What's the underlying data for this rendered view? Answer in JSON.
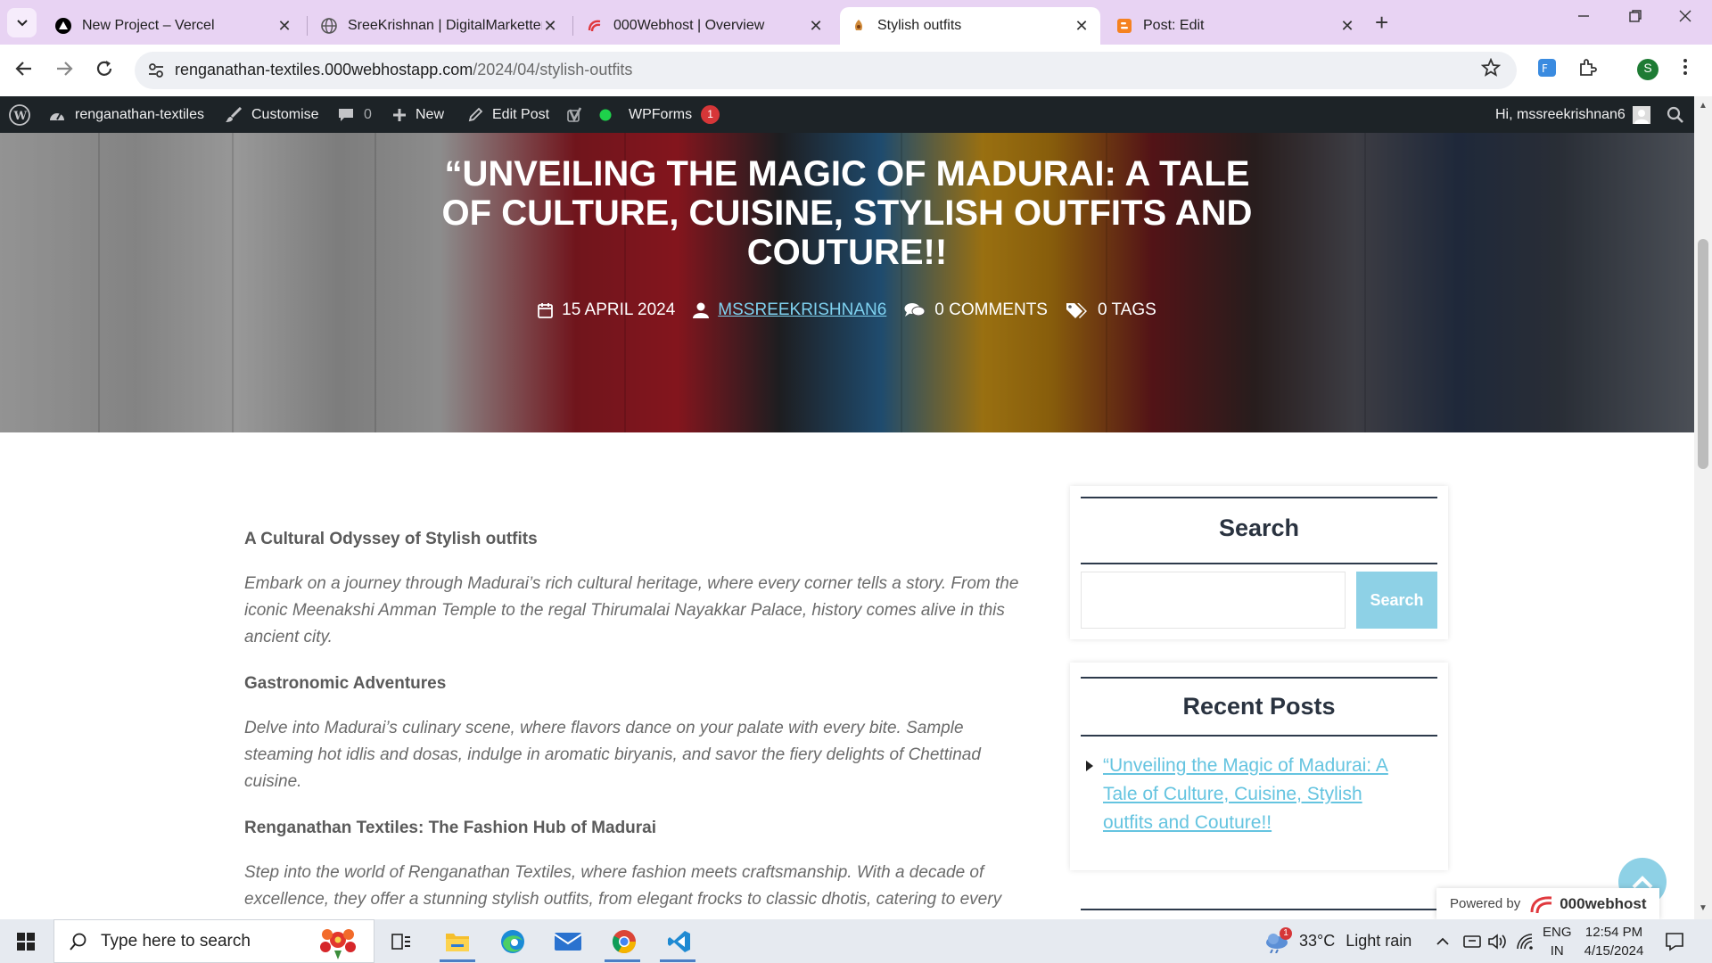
{
  "browser": {
    "tabs": [
      {
        "title": "New Project – Vercel",
        "icon": "vercel-icon"
      },
      {
        "title": "SreeKrishnan | DigitalMarketter",
        "icon": "globe-icon"
      },
      {
        "title": "000Webhost | Overview",
        "icon": "webhost-icon"
      },
      {
        "title": "Stylish outfits",
        "icon": "site-favicon-icon",
        "active": true
      },
      {
        "title": "Post: Edit",
        "icon": "blogger-icon"
      }
    ],
    "close_glyph": "✕",
    "new_tab_glyph": "+",
    "url_host": "renganathan-textiles.000webhostapp.com",
    "url_path": "/2024/04/stylish-outfits",
    "profile_initial": "S"
  },
  "adminbar": {
    "site_name": "renganathan-textiles",
    "customise": "Customise",
    "comments_count": "0",
    "new": "New",
    "edit_post": "Edit Post",
    "wpforms": "WPForms",
    "wpforms_badge": "1",
    "greeting": "Hi, mssreekrishnan6"
  },
  "hero": {
    "title": "“Unveiling the Magic of Madurai: A Tale of Culture, Cuisine, Stylish outfits and Couture!!",
    "date": "15 APRIL 2024",
    "author": "MSSREEKRISHNAN6",
    "comments": "0 COMMENTS",
    "tags": "0 TAGS"
  },
  "article": {
    "h1": "A Cultural Odyssey of Stylish outfits",
    "p1": " Embark on a journey through Madurai’s rich cultural heritage, where every corner tells a story. From the iconic Meenakshi Amman Temple to the regal Thirumalai Nayakkar Palace, history comes alive in this ancient city.",
    "h2": "Gastronomic Adventures",
    "p2": "Delve into Madurai’s culinary scene, where flavors dance on your palate with every bite. Sample steaming hot idlis and dosas, indulge in aromatic biryanis, and savor the fiery delights of Chettinad cuisine.",
    "h3": "Renganathan Textiles: The Fashion Hub of Madurai",
    "p3": "Step into the world of Renganathan Textiles, where fashion meets craftsmanship. With a decade of excellence, they offer a stunning stylish outfits, from elegant frocks to classic dhotis, catering to every"
  },
  "sidebar": {
    "search_title": "Search",
    "search_button": "Search",
    "search_value": "",
    "recent_title": "Recent Posts",
    "recent_posts": [
      "“Unveiling the Magic of Madurai: A Tale of Culture, Cuisine, Stylish outfits and Couture!!"
    ]
  },
  "powered": {
    "label": "Powered by",
    "brand": "000webhost"
  },
  "taskbar": {
    "search_placeholder": "Type here to search",
    "weather_temp": "33°C",
    "weather_desc": "Light rain",
    "weather_badge": "1",
    "lang_line1": "ENG",
    "lang_line2": "IN",
    "time": "12:54 PM",
    "date": "4/15/2024"
  },
  "colors": {
    "accent": "#8ed1e6",
    "link": "#65c4e0",
    "adminbar": "#1d2327",
    "tabstrip": "#e8d3f3"
  }
}
